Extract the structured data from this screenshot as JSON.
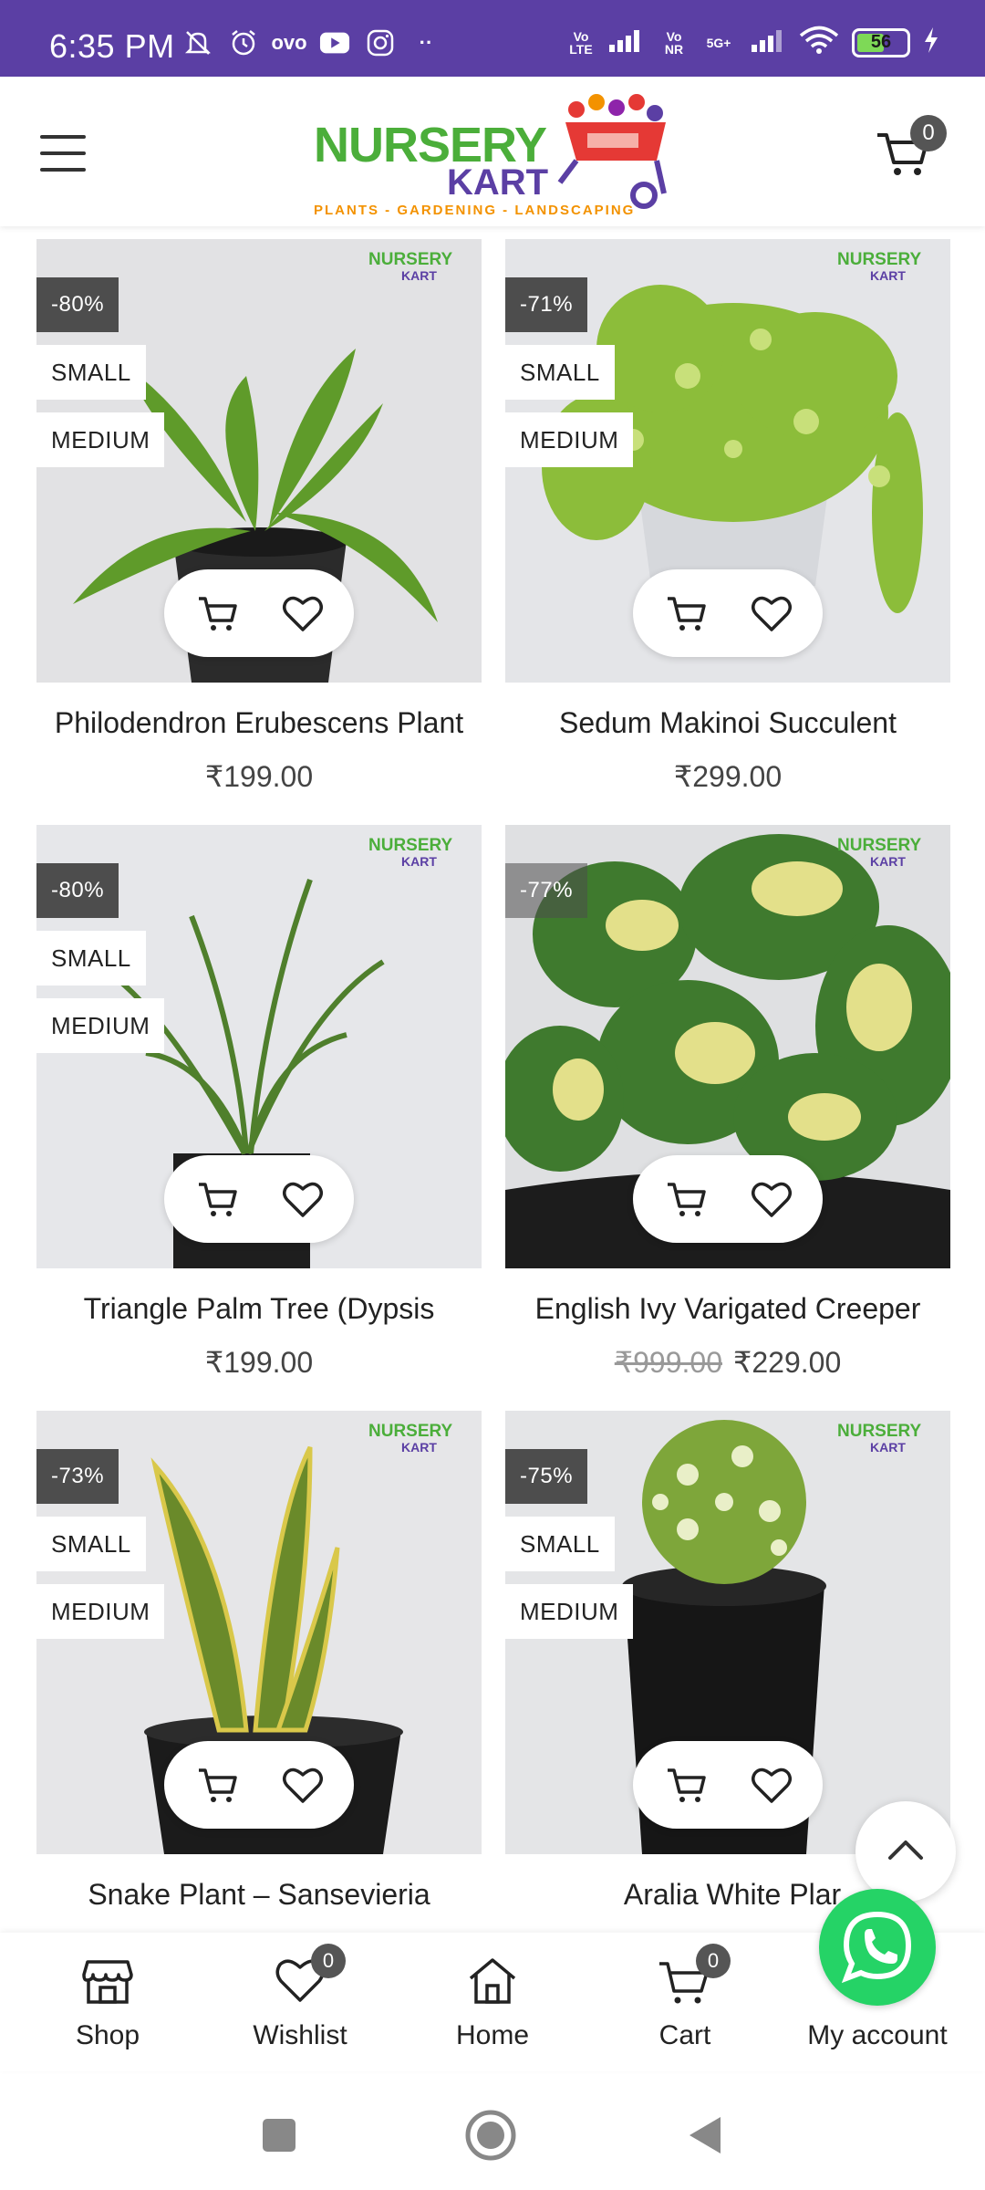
{
  "status_bar": {
    "time": "6:35 PM",
    "left_icons": [
      "mute-bell-icon",
      "alarm-icon",
      "ovo-icon",
      "youtube-icon",
      "instagram-icon",
      "more-dots-icon"
    ],
    "ovo_text": "ovo",
    "dots": "··",
    "volte_1": "Vo LTE",
    "volte_2": "Vo NR",
    "network": "5G+",
    "battery": "56"
  },
  "header": {
    "logo_line1": "NURSERY",
    "logo_line2": "KART",
    "logo_tagline": "PLANTS - GARDENING - LANDSCAPING",
    "cart_count": "0"
  },
  "watermark": {
    "line1": "NURSERY",
    "line2": "KART"
  },
  "products": [
    {
      "name": "Philodendron Erubescens Plant",
      "price": "₹199.00",
      "old_price": "",
      "discount": "-80%",
      "size1": "SMALL",
      "size2": "MEDIUM"
    },
    {
      "name": "Sedum Makinoi Succulent",
      "price": "₹299.00",
      "old_price": "",
      "discount": "-71%",
      "size1": "SMALL",
      "size2": "MEDIUM"
    },
    {
      "name": "Triangle Palm Tree (Dypsis",
      "price": "₹199.00",
      "old_price": "",
      "discount": "-80%",
      "size1": "SMALL",
      "size2": "MEDIUM"
    },
    {
      "name": "English Ivy Varigated Creeper",
      "price": "₹229.00",
      "old_price": "₹999.00",
      "discount": "-77%",
      "size1": "",
      "size2": ""
    },
    {
      "name": "Snake Plant – Sansevieria",
      "price": "",
      "old_price": "",
      "discount": "-73%",
      "size1": "SMALL",
      "size2": "MEDIUM"
    },
    {
      "name": "Aralia White Plar",
      "price": "",
      "old_price": "",
      "discount": "-75%",
      "size1": "SMALL",
      "size2": "MEDIUM"
    }
  ],
  "bottom_nav": {
    "shop": "Shop",
    "wishlist": "Wishlist",
    "wishlist_count": "0",
    "home": "Home",
    "cart": "Cart",
    "cart_count": "0",
    "account": "My account"
  },
  "colors": {
    "brand_purple": "#5b3fa4",
    "brand_green": "#4bae3a",
    "whatsapp": "#25d366",
    "discount_tag": "#4d4d4d"
  }
}
